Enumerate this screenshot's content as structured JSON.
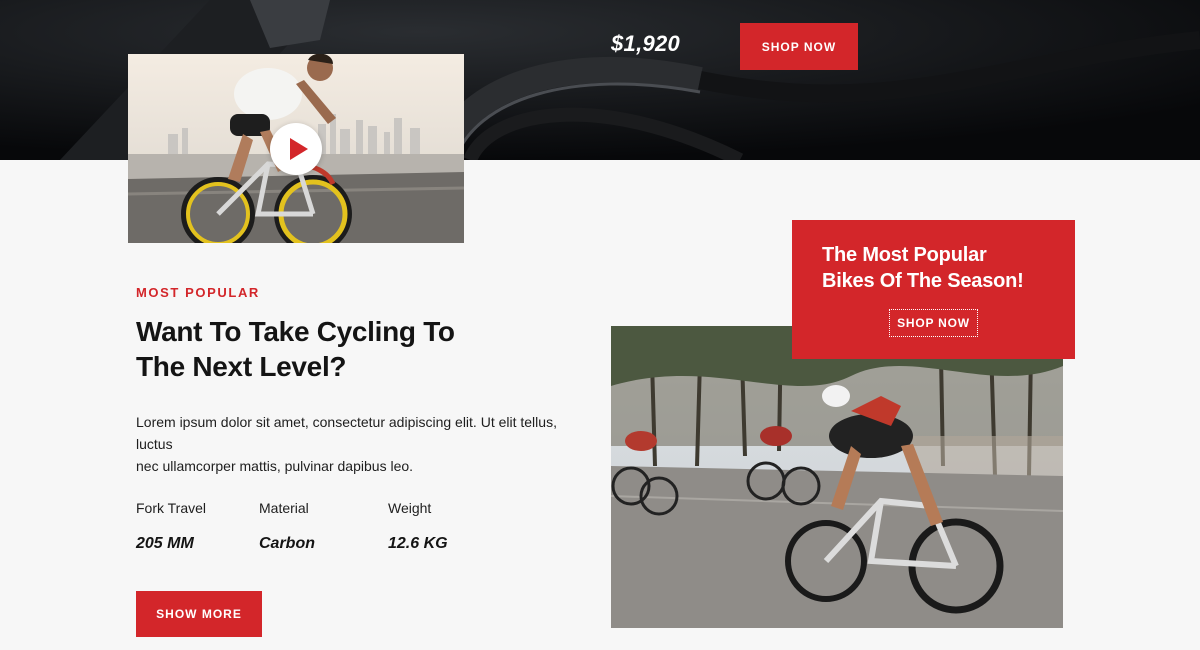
{
  "hero": {
    "price": "$1,920",
    "shop_label": "SHOP NOW"
  },
  "video": {
    "play_icon": "play-icon"
  },
  "feature": {
    "eyebrow": "MOST POPULAR",
    "headline_line1": "Want To Take Cycling To",
    "headline_line2": "The Next Level?",
    "body_line1": "Lorem ipsum dolor sit amet, consectetur adipiscing elit. Ut elit tellus, luctus",
    "body_line2": "nec ullamcorper mattis, pulvinar dapibus leo.",
    "specs": [
      {
        "label": "Fork Travel",
        "value": "205 MM"
      },
      {
        "label": "Material",
        "value": "Carbon"
      },
      {
        "label": "Weight",
        "value": "12.6 KG"
      }
    ],
    "show_more_label": "SHOW MORE"
  },
  "promo": {
    "title_line1": "The Most Popular",
    "title_line2": "Bikes Of The Season!",
    "shop_label": "SHOP NOW"
  },
  "colors": {
    "accent": "#d3262a",
    "hero_bg": "#0b0d10",
    "page_bg": "#f7f7f7"
  }
}
